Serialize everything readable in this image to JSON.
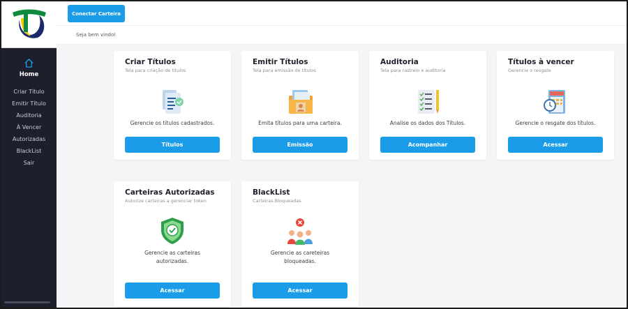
{
  "sidebar": {
    "home_label": "Home",
    "items": [
      {
        "label": "Criar Título"
      },
      {
        "label": "Emitir Título"
      },
      {
        "label": "Auditoria"
      },
      {
        "label": "À Vencer"
      },
      {
        "label": "Autorizadas"
      },
      {
        "label": "BlackList"
      },
      {
        "label": "Sair"
      }
    ]
  },
  "header": {
    "connect_button": "Conectar Carteira",
    "welcome": "Seja bem vindo!"
  },
  "cards": [
    {
      "title": "Criar Títulos",
      "subtitle": "Tela para criação de títulos",
      "description": "Gerencie os títulos cadastrados.",
      "button": "Títulos",
      "icon": "document-check-icon"
    },
    {
      "title": "Emitir Títulos",
      "subtitle": "Tela para emissão de títulos",
      "description": "Emita títulos para uma carteira.",
      "button": "Emissão",
      "icon": "folder-profile-icon"
    },
    {
      "title": "Auditoria",
      "subtitle": "Tela para rastreio e auditoria",
      "description": "Analise os dados dos Títulos.",
      "button": "Acompanhar",
      "icon": "checklist-pencil-icon"
    },
    {
      "title": "Títulos à vencer",
      "subtitle": "Gerencie o resgate",
      "description": "Gerencie o resgate dos títulos.",
      "button": "Acessar",
      "icon": "calendar-clock-icon"
    },
    {
      "title": "Carteiras Autorizadas",
      "subtitle": "Autorize carteiras a gerenciar token",
      "description_line1": "Gerencie as carteiras",
      "description_line2": "autorizadas.",
      "button": "Acessar",
      "icon": "shield-check-icon"
    },
    {
      "title": "BlackList",
      "subtitle": "Carteiras Bloqueadas",
      "description_line1": "Gerencie as careteiras",
      "description_line2": "bloqueadas.",
      "button": "Acessar",
      "icon": "blocked-group-icon"
    }
  ],
  "colors": {
    "accent": "#1a9ce8",
    "sidebar_bg": "#1e1f2c",
    "page_bg": "#f3f5f7"
  }
}
